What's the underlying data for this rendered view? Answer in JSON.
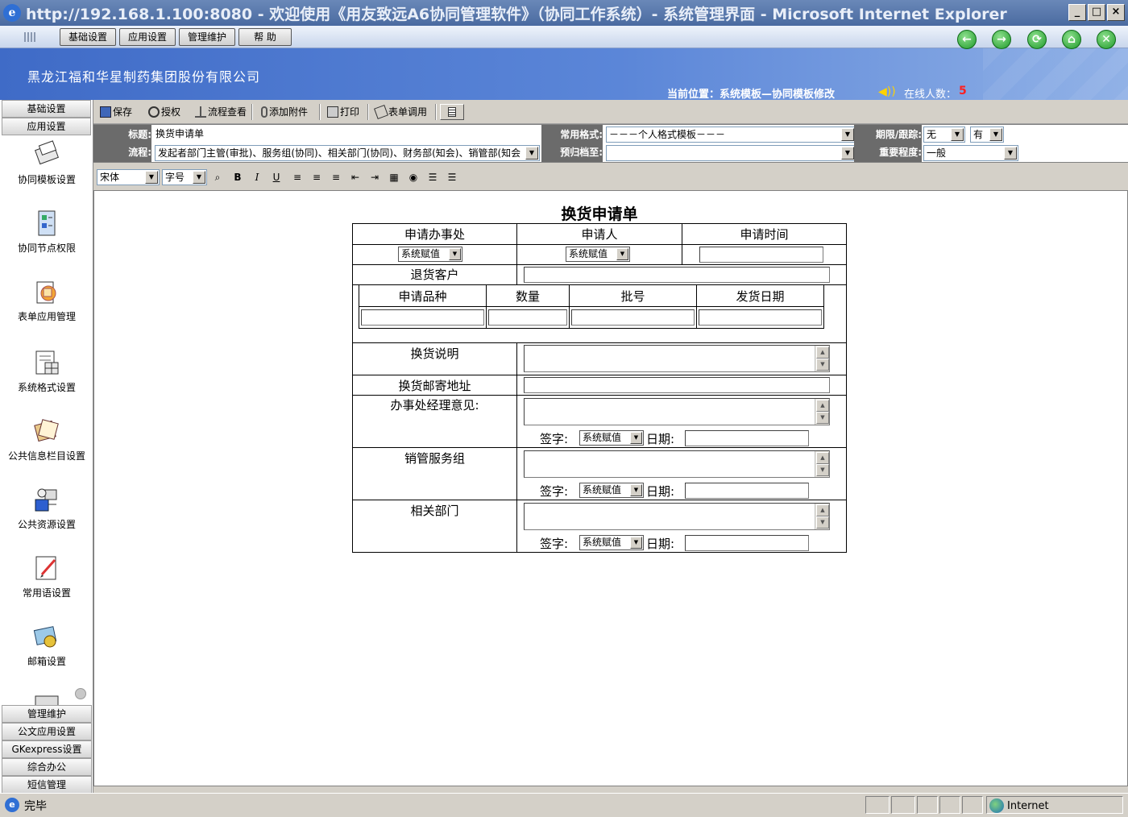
{
  "window": {
    "title": "http://192.168.1.100:8080 - 欢迎使用《用友致远A6协同管理软件》（协同工作系统）- 系统管理界面 - Microsoft Internet Explorer",
    "minimize": "_",
    "maximize": "□",
    "close": "×"
  },
  "menubar": {
    "items": [
      "基础设置",
      "应用设置",
      "管理维护",
      "帮 助"
    ]
  },
  "header": {
    "company": "黑龙江福和华星制药集团股份有限公司",
    "location": "当前位置：系统模板—协同模板修改",
    "online_label": "在线人数：",
    "online_count": "5",
    "nav": [
      "←",
      "→",
      "⟳",
      "⌂",
      "✕"
    ]
  },
  "sidebar": {
    "top_sections": [
      "基础设置",
      "应用设置"
    ],
    "items": [
      {
        "label": "协同模板设置",
        "icon": "template-icon"
      },
      {
        "label": "协同节点权限",
        "icon": "node-permission-icon"
      },
      {
        "label": "表单应用管理",
        "icon": "form-app-icon"
      },
      {
        "label": "系统格式设置",
        "icon": "format-icon"
      },
      {
        "label": "公共信息栏目设置",
        "icon": "info-column-icon"
      },
      {
        "label": "公共资源设置",
        "icon": "resource-icon"
      },
      {
        "label": "常用语设置",
        "icon": "phrase-icon"
      },
      {
        "label": "邮箱设置",
        "icon": "mailbox-icon"
      }
    ],
    "bottom_sections": [
      "管理维护",
      "公文应用设置",
      "GKexpress设置",
      "综合办公",
      "短信管理"
    ]
  },
  "toolbar": {
    "save": "保存",
    "authorize": "授权",
    "view_flow": "流程查看",
    "attach": "添加附件",
    "print": "打印",
    "form_call": "表单调用"
  },
  "form_header": {
    "title_label": "标题:",
    "title_value": "换货申请单",
    "flow_label": "流程:",
    "flow_value": "发起者部门主管(审批)、服务组(协同)、相关部门(协同)、财务部(知会)、销管部(知会",
    "format_label": "常用格式:",
    "format_value": "－－－个人格式模板－－－",
    "archive_label": "预归档至:",
    "archive_value": "",
    "deadline_label": "期限/跟踪:",
    "deadline_value": "无",
    "track_value": "有",
    "importance_label": "重要程度:",
    "importance_value": "一般"
  },
  "editor": {
    "font": "宋体",
    "size": "字号",
    "bold": "B",
    "italic": "I",
    "underline": "U"
  },
  "form": {
    "title": "换货申请单",
    "col_office": "申请办事处",
    "col_applicant": "申请人",
    "col_time": "申请时间",
    "sys_value": "系统赋值",
    "return_customer": "退货客户",
    "sub_variety": "申请品种",
    "sub_qty": "数量",
    "sub_batch": "批号",
    "sub_ship_date": "发货日期",
    "exchange_desc": "换货说明",
    "mail_address": "换货邮寄地址",
    "manager_opinion": "办事处经理意见:",
    "sales_group": "销管服务组",
    "related_dept": "相关部门",
    "sign_label": "签字:",
    "date_label": "日期:"
  },
  "status": {
    "text": "完毕",
    "zone": "Internet"
  }
}
